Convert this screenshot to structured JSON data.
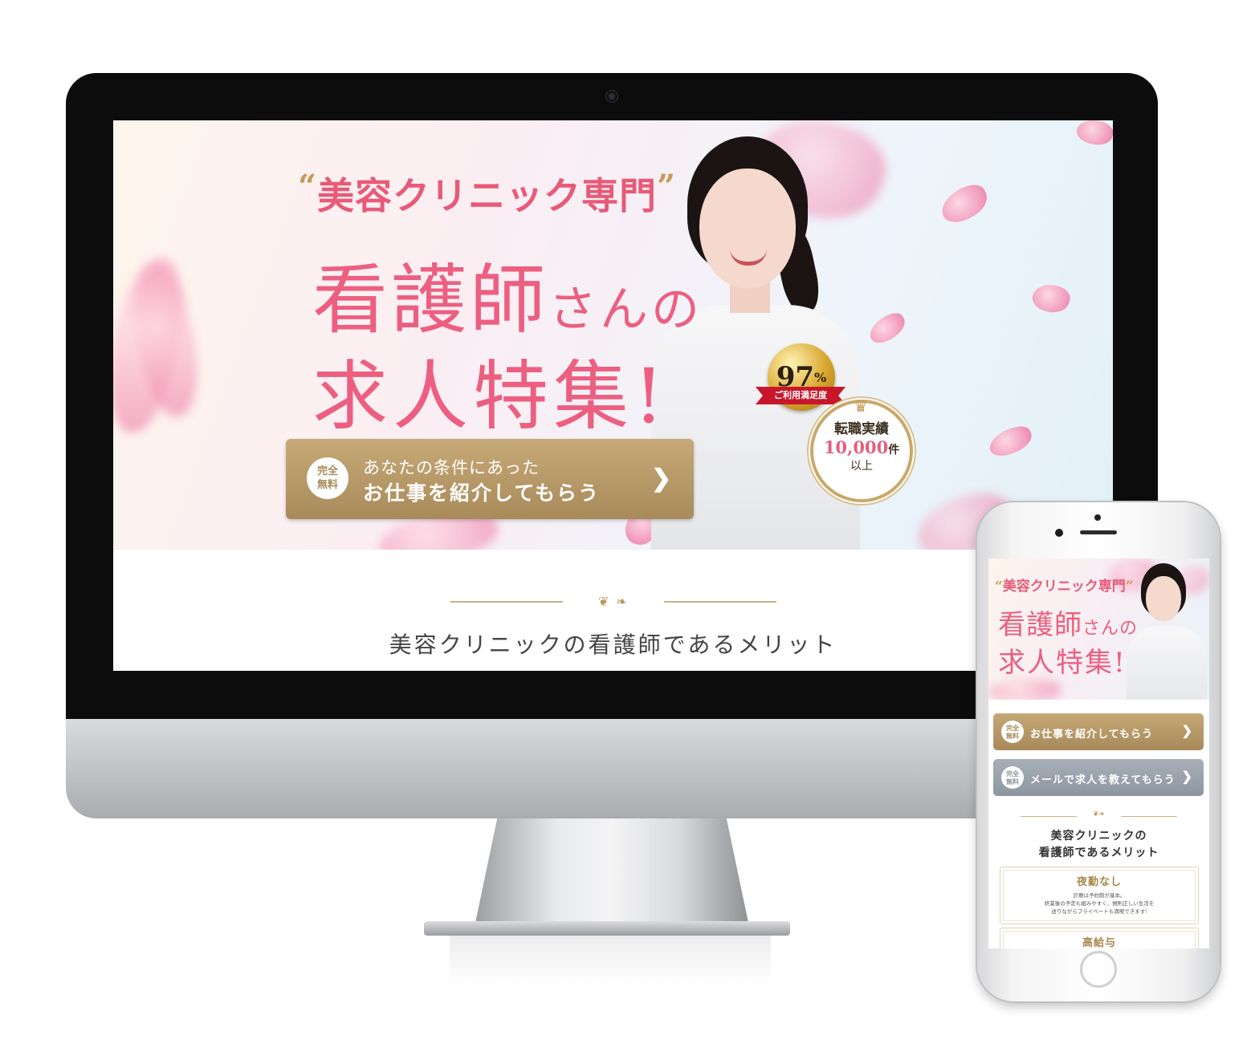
{
  "desktop": {
    "hero": {
      "quote_open": "“",
      "quote_title": "美容クリニック専門",
      "quote_close": "”",
      "line1_main": "看護師",
      "line1_small": "さんの",
      "line2": "求人特集!",
      "badge_value": "97",
      "badge_unit": "%",
      "badge_ribbon": "ご利用満足度",
      "seal_line1": "転職実績",
      "seal_number": "10,000",
      "seal_unit": "件",
      "seal_line3": "以上"
    },
    "cta": {
      "free_label_1": "完全",
      "free_label_2": "無料",
      "line1": "あなたの条件にあった",
      "line2": "お仕事を紹介してもらう",
      "arrow": "❯"
    },
    "section_heading": "美容クリニックの看護師であるメリット",
    "ornament": "❦ ❧"
  },
  "mobile": {
    "hero": {
      "quote_open": "“",
      "quote_title": "美容クリニック専門",
      "quote_close": "”",
      "line1_main": "看護師",
      "line1_small": "さんの",
      "line2": "求人特集!"
    },
    "buttons": [
      {
        "free_1": "完全",
        "free_2": "無料",
        "label": "お仕事を紹介してもらう",
        "arrow": "❯"
      },
      {
        "free_1": "完全",
        "free_2": "無料",
        "label": "メールで求人を教えてもらう",
        "arrow": "❯"
      }
    ],
    "ornament": "❦❧",
    "heading_line1": "美容クリニックの",
    "heading_line2": "看護師であるメリット",
    "cards": [
      {
        "title": "夜勤なし",
        "body_1": "診療は予約制が基本。",
        "body_2": "終業後の予定も組みやすく、規則正しい生活を",
        "body_3": "送りながらプライベートも満喫できます!"
      },
      {
        "title": "高給与"
      }
    ]
  },
  "colors": {
    "pink_title": "#ec5f80",
    "gold": "#b89558",
    "gold_button": "#a98b5b",
    "gray_button": "#8d96a0",
    "seal_red": "#c8172b"
  }
}
